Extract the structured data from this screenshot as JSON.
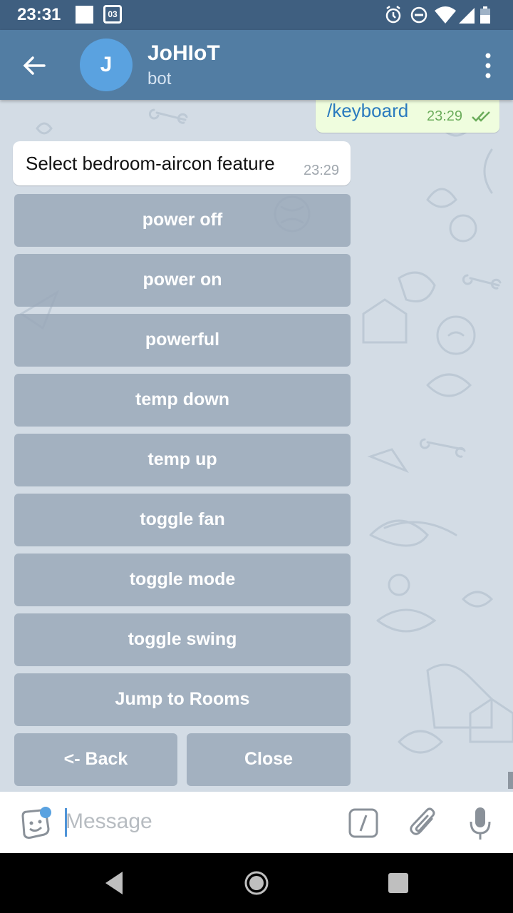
{
  "status_bar": {
    "time": "23:31",
    "calendar_date": "03"
  },
  "header": {
    "avatar_letter": "J",
    "title": "JoHIoT",
    "subtitle": "bot"
  },
  "messages": [
    {
      "direction": "outgoing",
      "text": "/keyboard",
      "time": "23:29",
      "status": "read"
    },
    {
      "direction": "incoming",
      "text": "Select bedroom-aircon feature",
      "time": "23:29"
    }
  ],
  "keyboard": {
    "buttons": [
      "power off",
      "power on",
      "powerful",
      "temp down",
      "temp up",
      "toggle fan",
      "toggle mode",
      "toggle swing",
      "Jump to Rooms"
    ],
    "last_row": [
      "<- Back",
      "Close"
    ]
  },
  "input": {
    "placeholder": "Message",
    "value": ""
  },
  "colors": {
    "status_bar": "#3f5f80",
    "app_bar": "#527da3",
    "avatar": "#5aa2e0",
    "outgoing_bubble": "#effdde",
    "chat_background": "#d3dce5"
  }
}
